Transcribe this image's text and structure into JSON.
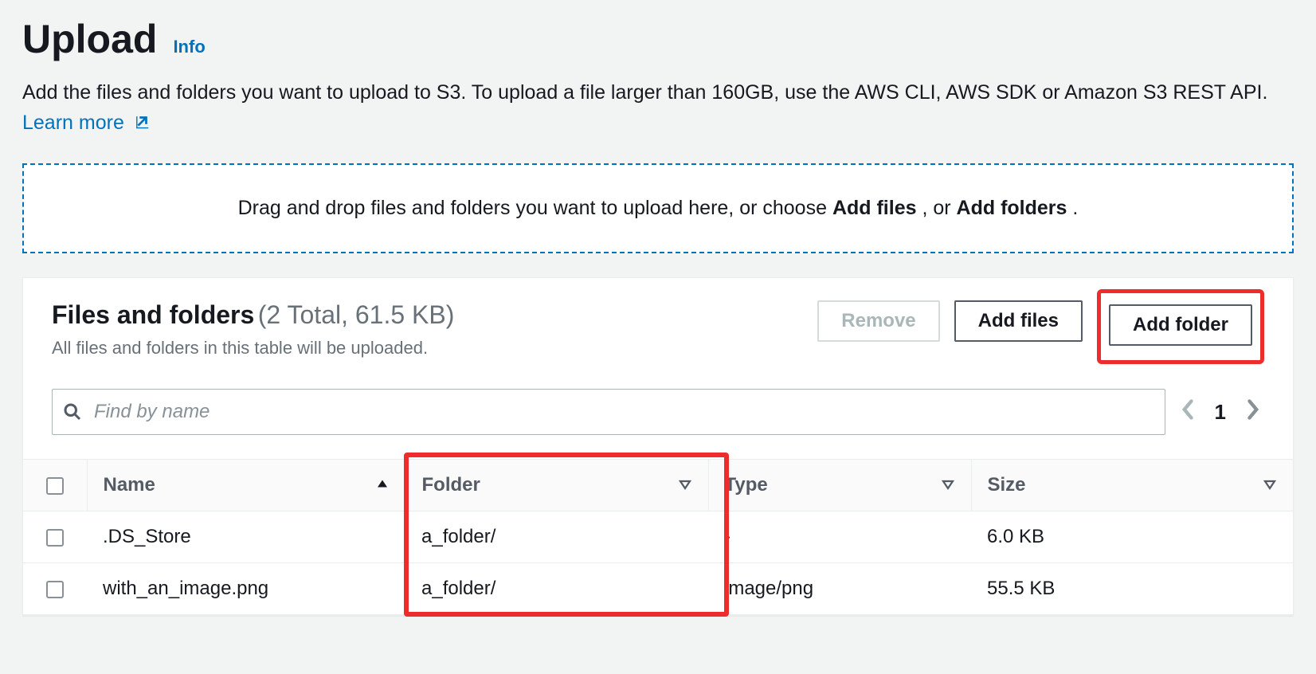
{
  "page": {
    "title": "Upload",
    "info_label": "Info",
    "description_part1": "Add the files and folders you want to upload to S3. To upload a file larger than 160GB, use the AWS CLI, AWS SDK or Amazon S3 REST API. ",
    "learn_more": "Learn more"
  },
  "dropzone": {
    "text_pre": "Drag and drop files and folders you want to upload here, or choose ",
    "add_files": "Add files",
    "sep": ", or ",
    "add_folders": "Add folders",
    "end": "."
  },
  "panel": {
    "title": "Files and folders",
    "count_summary": "(2 Total, 61.5 KB)",
    "subtitle": "All files and folders in this table will be uploaded.",
    "buttons": {
      "remove": "Remove",
      "add_files": "Add files",
      "add_folder": "Add folder"
    },
    "search_placeholder": "Find by name",
    "pagination": {
      "page": "1"
    }
  },
  "table": {
    "headers": {
      "name": "Name",
      "folder": "Folder",
      "type": "Type",
      "size": "Size"
    },
    "rows": [
      {
        "name": ".DS_Store",
        "folder": "a_folder/",
        "type": "-",
        "size": "6.0 KB"
      },
      {
        "name": "with_an_image.png",
        "folder": "a_folder/",
        "type": "image/png",
        "size": "55.5 KB"
      }
    ]
  }
}
